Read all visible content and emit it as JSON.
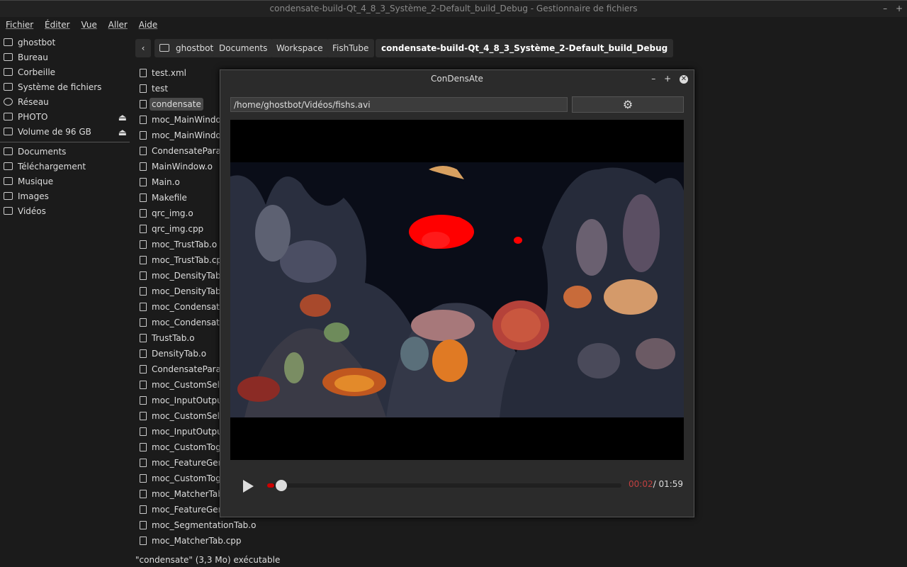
{
  "window": {
    "title": "condensate-build-Qt_4_8_3_Système_2-Default_build_Debug - Gestionnaire de fichiers",
    "minimize": "–",
    "maximize": "+",
    "close": "✕"
  },
  "menu": [
    "Fichier",
    "Éditer",
    "Vue",
    "Aller",
    "Aide"
  ],
  "sidebar": {
    "places": [
      {
        "label": "ghostbot",
        "icon": "home-folder-icon"
      },
      {
        "label": "Bureau",
        "icon": "desktop-icon"
      },
      {
        "label": "Corbeille",
        "icon": "trash-icon"
      },
      {
        "label": "Système de fichiers",
        "icon": "drive-icon"
      },
      {
        "label": "Réseau",
        "icon": "network-icon"
      },
      {
        "label": "PHOTO",
        "icon": "drive-icon",
        "eject": "⏏"
      },
      {
        "label": "Volume de 96 GB",
        "icon": "drive-icon",
        "eject": "⏏"
      }
    ],
    "bookmarks": [
      {
        "label": "Documents",
        "icon": "folder-icon"
      },
      {
        "label": "Téléchargement",
        "icon": "folder-icon"
      },
      {
        "label": "Musique",
        "icon": "folder-icon"
      },
      {
        "label": "Images",
        "icon": "folder-icon"
      },
      {
        "label": "Vidéos",
        "icon": "folder-icon"
      }
    ]
  },
  "pathbar": {
    "back": "‹",
    "crumbs": [
      "ghostbot",
      "Documents",
      "Workspace",
      "FishTube",
      "condensate-build-Qt_4_8_3_Système_2-Default_build_Debug"
    ]
  },
  "files": [
    "test.xml",
    "test",
    "condensate",
    "moc_MainWindow",
    "moc_MainWindow",
    "CondensateParam",
    "MainWindow.o",
    "Main.o",
    "Makefile",
    "qrc_img.o",
    "qrc_img.cpp",
    "moc_TrustTab.o",
    "moc_TrustTab.cpp",
    "moc_DensityTab.o",
    "moc_DensityTab.c",
    "moc_CondensateF",
    "moc_CondensateF",
    "TrustTab.o",
    "DensityTab.o",
    "CondensateParam",
    "moc_CustomSelec",
    "moc_InputOutput",
    "moc_CustomSelec",
    "moc_InputOutput",
    "moc_CustomTogg",
    "moc_FeatureGene",
    "moc_CustomTogg",
    "moc_MatcherTab.",
    "moc_FeatureGene",
    "moc_SegmentationTab.o",
    "moc_MatcherTab.cpp"
  ],
  "selected_file_index": 2,
  "status": "\"condensate\" (3,3 Mo) exécutable",
  "dialog": {
    "title": "ConDensAte",
    "minimize": "–",
    "maximize": "+",
    "close": "✕",
    "path": "/home/ghostbot/Vidéos/fishs.avi",
    "settings_icon": "gear-icon",
    "settings_glyph": "⚙",
    "play_icon": "play-icon",
    "progress_fraction": 0.02,
    "time_current": "00:02",
    "time_total": "/ 01:59"
  }
}
